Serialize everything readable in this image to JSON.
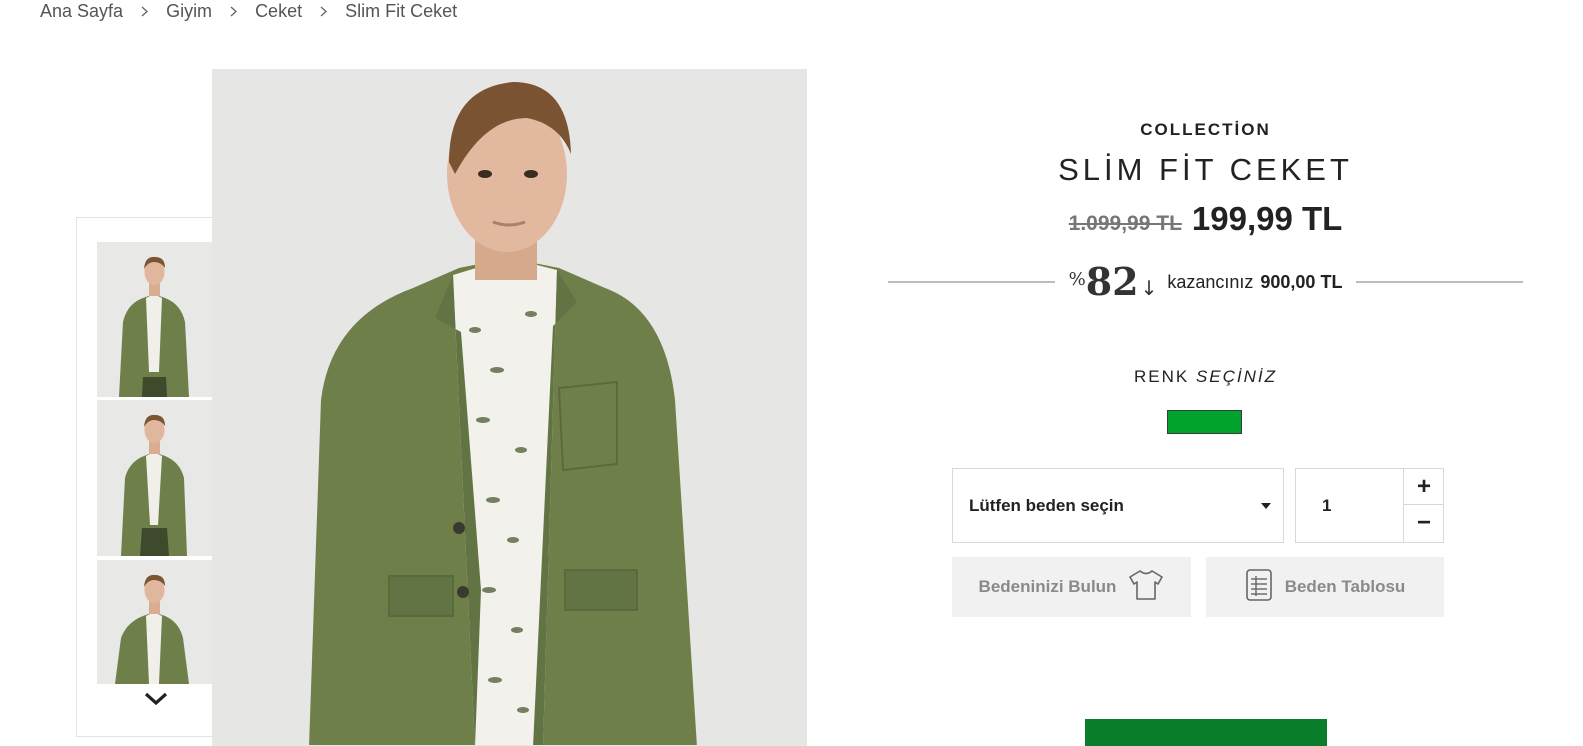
{
  "breadcrumb": {
    "items": [
      "Ana Sayfa",
      "Giyim",
      "Ceket",
      "Slim Fit Ceket"
    ]
  },
  "product": {
    "brand": "COLLECTİON",
    "title": "SLİM FİT CEKET",
    "old_price": "1.099,99 TL",
    "new_price": "199,99 TL",
    "discount": {
      "percent_sign": "%",
      "value": "82",
      "arrow": "↓",
      "saving_label": "kazancınız",
      "saving_amount": "900,00 TL"
    },
    "color": {
      "label": "RENK",
      "label_em": "SEÇİNİZ",
      "swatches": [
        {
          "color": "#00a32c"
        }
      ]
    },
    "size_select": {
      "placeholder": "Lütfen beden seçin"
    },
    "quantity": {
      "value": "1",
      "plus": "+",
      "minus": "−"
    },
    "find_size_label": "Bedeninizi Bulun",
    "size_table_label": "Beden Tablosu"
  },
  "colors": {
    "jacket": "#6e7f4a",
    "swatch": "#00a32c",
    "add_to_cart": "#0a7d2a"
  },
  "icons": {
    "breadcrumb_separator": "chevron-right-icon",
    "thumb_scroll": "chevron-down-icon",
    "find_size": "tshirt-icon",
    "size_table": "table-icon"
  }
}
